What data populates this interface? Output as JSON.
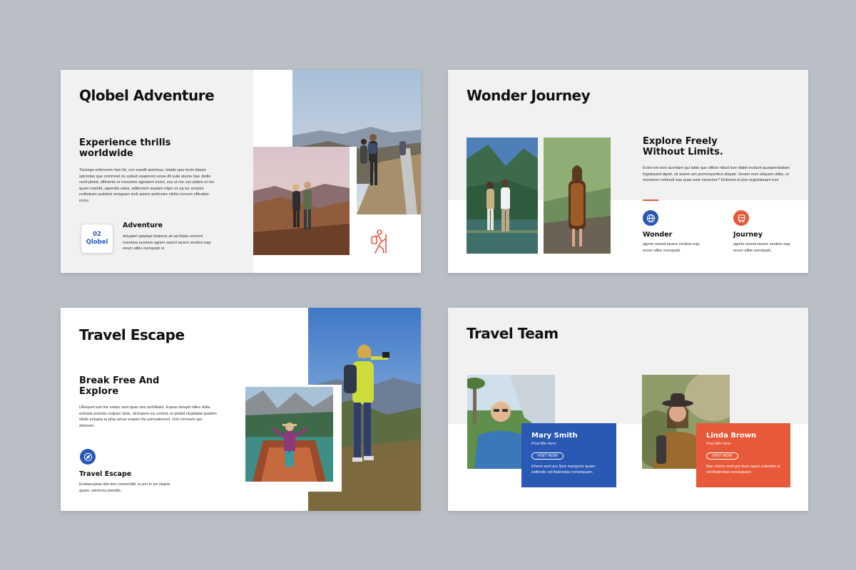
{
  "colors": {
    "blue": "#2a58b5",
    "orange": "#e8593a",
    "background": "#b9bfc5"
  },
  "slide1": {
    "title": "Qlobel Adventure",
    "subtitle": "Experience thrills worldwide",
    "body": "Tacimpe exferorem fam hit, con esedit asinimus, totatio quo tecto blaute spictotas que commnet es subuit usaperem eosa dit aute eiume bae dedio ovvit plebit, officienis re mossime agnatem inctol, sus ut mo cus plabio ut rex quam eamdit, aipendis eatur, aditectem aeptam mipo es ep tur aceptur reditubam asdebet amiquam sinti autem antimuire nihiliu iccoum officabor romo.",
    "badge_num": "02",
    "badge_name": "Qlobel",
    "label": "Adventure",
    "label_text": "doluptet optatqut biaboris sit ad blatio eercimi nvenima eoximm agnim resent iacere vention eap enum alibe eumquati re",
    "icon": "hiker-icon"
  },
  "slide2": {
    "title": "Wonder Journey",
    "subtitle": "Explore Freely Without Limits.",
    "body": "Ectot ext exnt aceritam qui lattio quo officie nibuit lure diabit ecidunt quaspientatiam fugiatqued dipsit, sit autem am porroreperfect aliquat. Xeram eum aliquam alibe, ut niciminen veilendi eaa quas ame noneutur? Doloreet et pos ergiutatiuam lure",
    "icons": [
      {
        "name": "Wonder",
        "text": "agnim resent iacere vention eap enum alibe eumquati.",
        "icon": "globe-icon"
      },
      {
        "name": "Journey",
        "text": "agnim resent iacere vention eap enum alibe eumquati.",
        "icon": "bus-icon"
      }
    ]
  },
  "slide3": {
    "title": "Travel Escape",
    "subtitle": "Break Free And Explore",
    "body": "Ullisquet lust the estias sant quas dos anihillabo. Eqeas dolupit nilles dolla ectesiis poreste nulparc isimi, olcinanes ea comnis re pedsit olupitatat quatem nibile eolupta ar pliar amus erspen ilis sumsatiorunt. Ucit corosum qui dolorem.",
    "label": "Travel Escape",
    "label_text": "Endaeruptas alis tem consecidit, te pro in pe olupta quam, utemoxu peindis.",
    "icon": "compass-icon"
  },
  "slide4": {
    "title": "Travel Team",
    "members": [
      {
        "name": "Mary Smith",
        "post": "Post title Here",
        "button": "VISIT NOW",
        "text": "Eheno sent pro liure marquino quam sollende vel-litatendao nonsequam."
      },
      {
        "name": "Linda Brown",
        "post": "Post title Here",
        "button": "VISIT NOW",
        "text": "Non eheno sent pro liure quam solendet ol vel-litatendao nonsequam."
      }
    ]
  }
}
